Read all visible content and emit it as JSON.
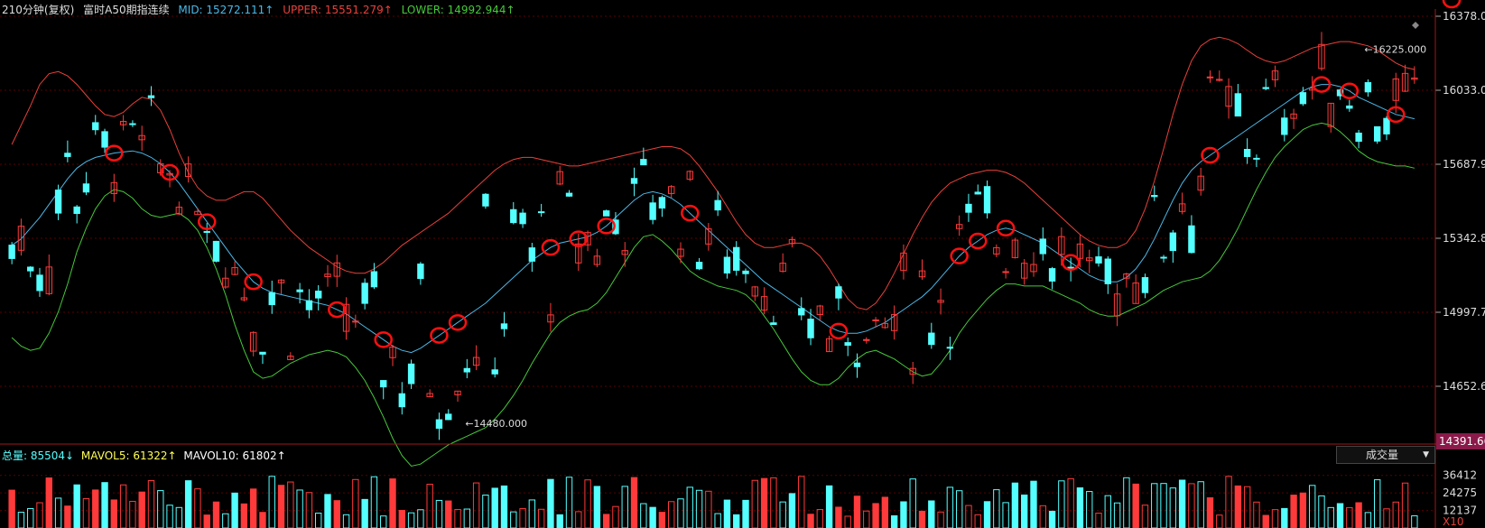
{
  "header": {
    "period": "210分钟(复权)",
    "instrument": "富时A50期指连续",
    "mid": "MID: 15272.111↑",
    "upper": "UPPER: 15551.279↑",
    "lower": "LOWER: 14992.944↑"
  },
  "colors": {
    "background": "#000000",
    "up_candle": "#ff3a3a",
    "down_candle": "#54ffff",
    "mid_line": "#4ab8e8",
    "upper_line": "#e8403a",
    "lower_line": "#46c83a",
    "grid": "#5a0000",
    "price_tag_bg": "#8a1a4a",
    "annotation": "#ff1010",
    "mavol5": "#ffff55",
    "mavol10": "#ffffff"
  },
  "volume_header": {
    "total": "总量: 85504↓",
    "mavol5": "MAVOL5: 61322↑",
    "mavol10": "MAVOL10: 61802↑"
  },
  "indicator_select": {
    "value": "成交量",
    "arrow": "▼"
  },
  "chart_data": [
    {
      "type": "candlestick",
      "series": [
        {
          "name": "MID",
          "values": [
            15310,
            15340,
            15390,
            15440,
            15500,
            15560,
            15620,
            15670,
            15700,
            15720,
            15730,
            15740,
            15745,
            15750,
            15740,
            15720,
            15690,
            15650,
            15600,
            15540,
            15480,
            15420,
            15360,
            15300,
            15240,
            15190,
            15140,
            15110,
            15090,
            15080,
            15070,
            15060,
            15050,
            15040,
            15030,
            15010,
            14990,
            14960,
            14930,
            14900,
            14870,
            14840,
            14820,
            14810,
            14830,
            14860,
            14890,
            14920,
            14950,
            14980,
            15010,
            15040,
            15080,
            15120,
            15160,
            15200,
            15240,
            15270,
            15300,
            15320,
            15330,
            15340,
            15350,
            15370,
            15400,
            15440,
            15480,
            15520,
            15550,
            15560,
            15550,
            15530,
            15500,
            15460,
            15420,
            15380,
            15340,
            15300,
            15260,
            15220,
            15180,
            15140,
            15110,
            15080,
            15050,
            15020,
            14990,
            14960,
            14930,
            14910,
            14900,
            14900,
            14910,
            14930,
            14950,
            14980,
            15010,
            15040,
            15070,
            15110,
            15160,
            15210,
            15260,
            15300,
            15330,
            15360,
            15380,
            15390,
            15380,
            15360,
            15340,
            15320,
            15290,
            15260,
            15230,
            15200,
            15170,
            15150,
            15140,
            15140,
            15160,
            15200,
            15260,
            15340,
            15430,
            15520,
            15600,
            15660,
            15700,
            15730,
            15760,
            15790,
            15820,
            15850,
            15880,
            15910,
            15940,
            15970,
            16000,
            16030,
            16050,
            16060,
            16060,
            16050,
            16030,
            16000,
            15980,
            15960,
            15940,
            15920,
            15910,
            15900
          ]
        },
        {
          "name": "UPPER",
          "values": [
            15780,
            15870,
            15960,
            16060,
            16110,
            16120,
            16100,
            16060,
            16010,
            15960,
            15920,
            15910,
            15930,
            15970,
            16000,
            15990,
            15940,
            15850,
            15740,
            15650,
            15580,
            15540,
            15520,
            15520,
            15540,
            15560,
            15560,
            15530,
            15480,
            15430,
            15380,
            15340,
            15300,
            15270,
            15240,
            15210,
            15190,
            15180,
            15180,
            15200,
            15230,
            15270,
            15310,
            15340,
            15370,
            15400,
            15430,
            15460,
            15500,
            15540,
            15580,
            15620,
            15660,
            15690,
            15710,
            15720,
            15720,
            15710,
            15700,
            15690,
            15680,
            15680,
            15690,
            15700,
            15710,
            15720,
            15730,
            15740,
            15750,
            15760,
            15770,
            15770,
            15760,
            15730,
            15680,
            15620,
            15560,
            15490,
            15420,
            15360,
            15320,
            15300,
            15300,
            15310,
            15320,
            15320,
            15300,
            15260,
            15200,
            15130,
            15060,
            15020,
            15010,
            15040,
            15100,
            15180,
            15270,
            15360,
            15440,
            15510,
            15560,
            15600,
            15620,
            15640,
            15650,
            15660,
            15660,
            15650,
            15630,
            15600,
            15560,
            15520,
            15480,
            15440,
            15400,
            15360,
            15330,
            15310,
            15300,
            15300,
            15320,
            15380,
            15480,
            15610,
            15760,
            15920,
            16060,
            16170,
            16240,
            16270,
            16280,
            16270,
            16250,
            16220,
            16190,
            16170,
            16160,
            16170,
            16190,
            16210,
            16230,
            16240,
            16250,
            16260,
            16260,
            16250,
            16240,
            16220,
            16190,
            16160,
            16140,
            16130
          ]
        },
        {
          "name": "LOWER",
          "values": [
            14880,
            14840,
            14820,
            14830,
            14900,
            15000,
            15130,
            15280,
            15390,
            15480,
            15540,
            15570,
            15560,
            15530,
            15480,
            15450,
            15440,
            15450,
            15460,
            15430,
            15380,
            15300,
            15200,
            15080,
            14940,
            14820,
            14720,
            14690,
            14700,
            14730,
            14760,
            14780,
            14800,
            14810,
            14820,
            14810,
            14790,
            14740,
            14680,
            14600,
            14510,
            14410,
            14330,
            14280,
            14290,
            14320,
            14350,
            14380,
            14400,
            14420,
            14440,
            14460,
            14500,
            14550,
            14610,
            14680,
            14760,
            14830,
            14900,
            14950,
            14980,
            15000,
            15010,
            15040,
            15090,
            15160,
            15230,
            15300,
            15350,
            15360,
            15330,
            15290,
            15240,
            15190,
            15160,
            15140,
            15120,
            15110,
            15100,
            15080,
            15040,
            14980,
            14920,
            14850,
            14780,
            14720,
            14680,
            14660,
            14660,
            14690,
            14740,
            14780,
            14810,
            14820,
            14800,
            14780,
            14750,
            14720,
            14700,
            14710,
            14760,
            14820,
            14900,
            14960,
            15010,
            15060,
            15100,
            15130,
            15130,
            15120,
            15120,
            15120,
            15100,
            15080,
            15060,
            15040,
            15010,
            14990,
            14980,
            14980,
            15000,
            15020,
            15040,
            15070,
            15100,
            15120,
            15140,
            15150,
            15160,
            15190,
            15240,
            15310,
            15390,
            15480,
            15570,
            15650,
            15720,
            15770,
            15810,
            15850,
            15870,
            15880,
            15870,
            15840,
            15800,
            15750,
            15720,
            15700,
            15690,
            15680,
            15680,
            15670
          ]
        }
      ],
      "y_axis_ticks": [
        "16378.094",
        "16033.012",
        "15687.93",
        "15342.849",
        "14997.767",
        "14652.685"
      ],
      "last_price_tag": "14391.662",
      "annotations": [
        {
          "label": "←16225.000"
        },
        {
          "label": "←14480.000"
        }
      ],
      "ylim": [
        14391.662,
        16378.094
      ]
    },
    {
      "type": "bar",
      "y_axis_ticks": [
        "36412",
        "24275",
        "12137"
      ],
      "unit_label": "X10"
    }
  ]
}
